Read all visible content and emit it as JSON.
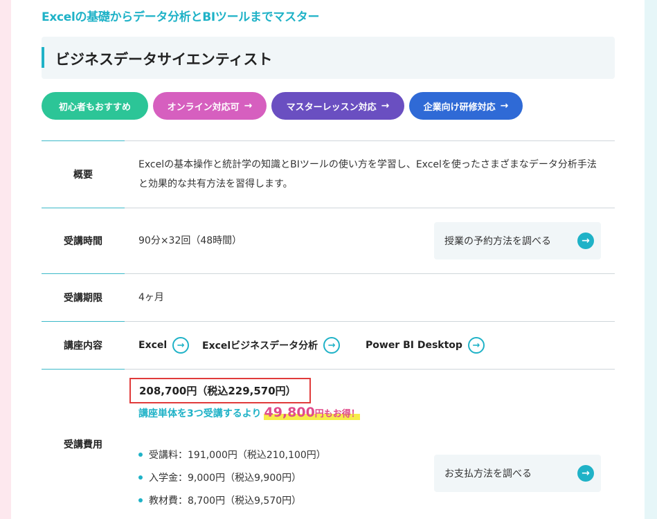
{
  "subtitle": "Excelの基礎からデータ分析とBIツールまでマスター",
  "course_title": "ビジネスデータサイエンティスト",
  "tags": [
    {
      "label": "初心者もおすすめ",
      "arrow": ""
    },
    {
      "label": "オンライン対応可",
      "arrow": "→"
    },
    {
      "label": "マスターレッスン対応",
      "arrow": "→"
    },
    {
      "label": "企業向け研修対応",
      "arrow": "→"
    }
  ],
  "overview": {
    "label": "概要",
    "text": "Excelの基本操作と統計学の知識とBIツールの使い方を学習し、Excelを使ったさまざまなデータ分析手法と効果的な共有方法を習得します。"
  },
  "duration": {
    "label": "受講時間",
    "value": "90分×32回（48時間）",
    "button_label": "授業の予約方法を調べる"
  },
  "period": {
    "label": "受講期限",
    "value": "4ヶ月"
  },
  "contents": {
    "label": "講座内容",
    "courses": [
      "Excel",
      "Excelビジネスデータ分析",
      "Power BI Desktop"
    ]
  },
  "fee": {
    "label": "受講費用",
    "total": "208,700円（税込229,570円）",
    "saving_prefix": "講座単体を3つ受講するより",
    "saving_amount": "49,800",
    "saving_suffix": "円もお得！",
    "items": [
      "受講料：191,000円（税込210,100円）",
      "入学金：9,000円（税込9,900円）",
      "教材費：8,700円（税込9,570円）"
    ],
    "button_label": "お支払方法を調べる"
  },
  "icons": {
    "arrow_glyph": "→"
  },
  "colors": {
    "accent": "#1fb2c7",
    "green": "#2cc597",
    "pink": "#d65fbf",
    "purple": "#6a4fc1",
    "blue": "#2f6ad6",
    "red_border": "#e03a3a",
    "highlight": "#f7ec4a"
  }
}
